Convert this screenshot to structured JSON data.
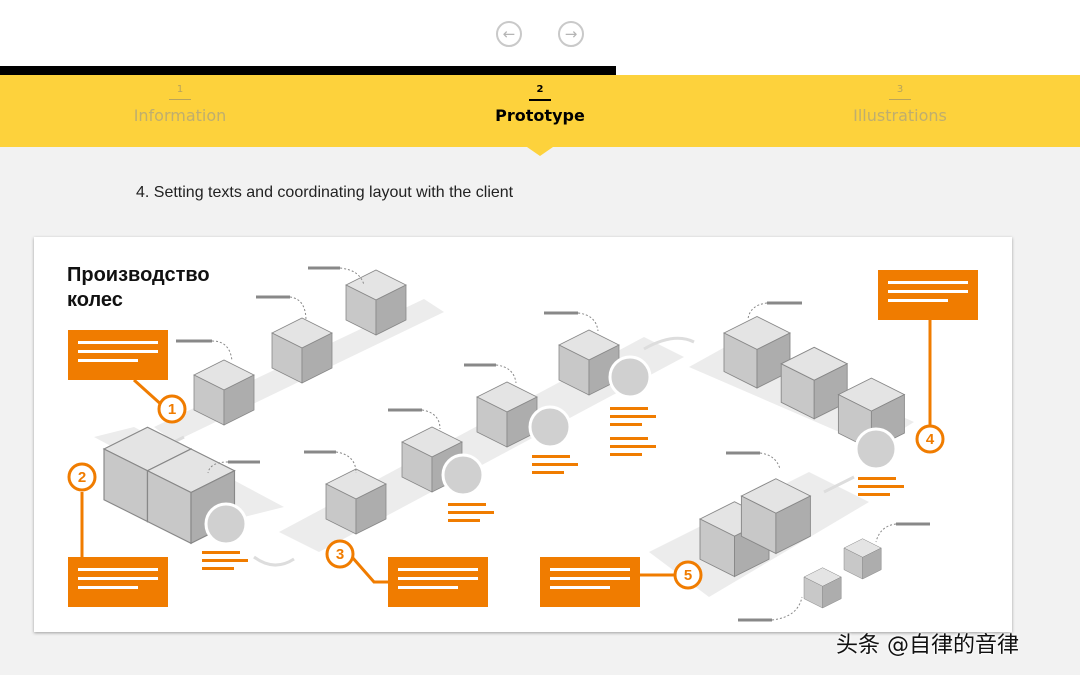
{
  "nav": {
    "prev_icon": "arrow-left-icon",
    "next_icon": "arrow-right-icon",
    "progress_fraction": 0.57
  },
  "steps": [
    {
      "num": "1",
      "label": "Information",
      "active": false
    },
    {
      "num": "2",
      "label": "Prototype",
      "active": true
    },
    {
      "num": "3",
      "label": "Illustrations",
      "active": false
    }
  ],
  "subtitle": "4. Setting texts and coordinating layout with the client",
  "diagram": {
    "title_line1": "Производство",
    "title_line2": "колес",
    "markers": [
      "1",
      "2",
      "3",
      "4",
      "5"
    ],
    "accent_color": "#f07c00",
    "box_color": "#c8c8c8"
  },
  "watermark": "头条 @自律的音律",
  "colors": {
    "step_bar": "#fdd23c",
    "accent": "#f07c00"
  }
}
